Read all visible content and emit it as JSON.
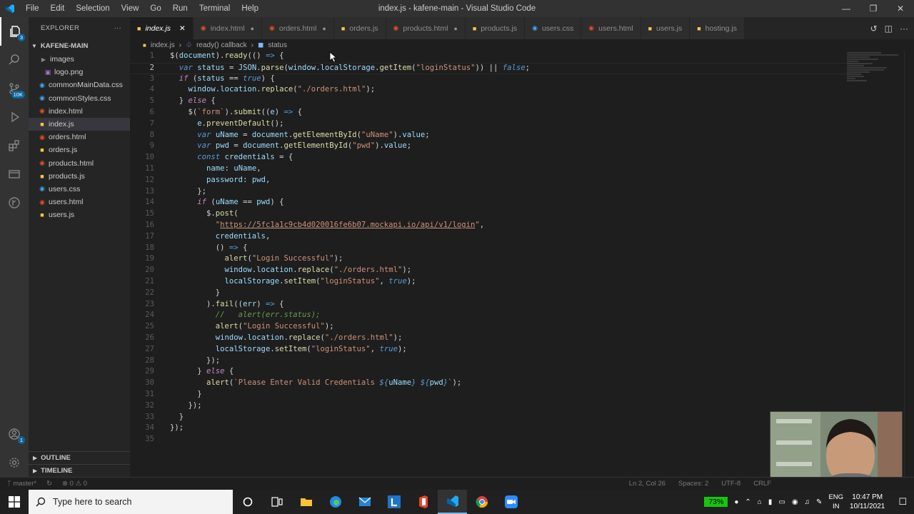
{
  "window": {
    "title": "index.js - kafene-main - Visual Studio Code",
    "menu": [
      "File",
      "Edit",
      "Selection",
      "View",
      "Go",
      "Run",
      "Terminal",
      "Help"
    ]
  },
  "activity": {
    "scm_badge": "3",
    "ext_badge": "10K",
    "account_badge": "1"
  },
  "explorer": {
    "header": "EXPLORER",
    "folder": "KAFENE-MAIN",
    "items": [
      {
        "label": "images",
        "type": "folder"
      },
      {
        "label": "logo.png",
        "type": "img"
      },
      {
        "label": "commonMainData.css",
        "type": "css"
      },
      {
        "label": "commonStyles.css",
        "type": "css"
      },
      {
        "label": "index.html",
        "type": "html"
      },
      {
        "label": "index.js",
        "type": "js"
      },
      {
        "label": "orders.html",
        "type": "html"
      },
      {
        "label": "orders.js",
        "type": "js"
      },
      {
        "label": "products.html",
        "type": "html"
      },
      {
        "label": "products.js",
        "type": "js"
      },
      {
        "label": "users.css",
        "type": "css"
      },
      {
        "label": "users.html",
        "type": "html"
      },
      {
        "label": "users.js",
        "type": "js"
      }
    ],
    "outline": "OUTLINE",
    "timeline": "TIMELINE"
  },
  "tabs": [
    {
      "label": "index.js",
      "type": "js"
    },
    {
      "label": "index.html",
      "type": "html"
    },
    {
      "label": "orders.html",
      "type": "html"
    },
    {
      "label": "orders.js",
      "type": "js"
    },
    {
      "label": "products.html",
      "type": "html"
    },
    {
      "label": "products.js",
      "type": "js"
    },
    {
      "label": "users.css",
      "type": "css"
    },
    {
      "label": "users.html",
      "type": "html"
    },
    {
      "label": "users.js",
      "type": "js"
    },
    {
      "label": "hosting.js",
      "type": "js"
    }
  ],
  "breadcrumb": {
    "file": "index.js",
    "fn": "ready() callback",
    "symbol": "status"
  },
  "status": {
    "branch": "master*",
    "problems": "0 ⚠ 0",
    "position": "Ln 2, Col 26",
    "spaces": "Spaces: 2",
    "encoding": "UTF-8",
    "eol": "CRLF"
  },
  "taskbar": {
    "search_placeholder": "Type here to search",
    "battery": "73%",
    "lang1": "ENG",
    "lang2": "IN",
    "time": "10:47 PM",
    "date": "10/11/2021"
  }
}
